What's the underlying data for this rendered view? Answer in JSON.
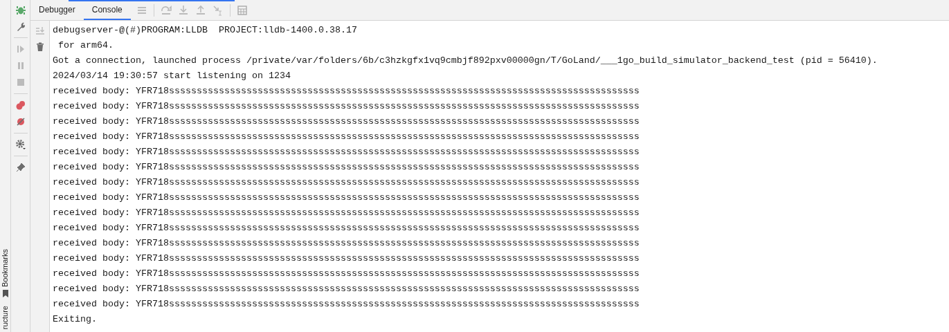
{
  "side_bar": {
    "items": [
      {
        "label": "Bookmarks"
      },
      {
        "label": "ructure"
      }
    ]
  },
  "tabs": [
    {
      "label": "Debugger",
      "selected": false
    },
    {
      "label": "Console",
      "selected": true
    }
  ],
  "console": {
    "lines": [
      "debugserver-@(#)PROGRAM:LLDB  PROJECT:lldb-1400.0.38.17",
      " for arm64.",
      "Got a connection, launched process /private/var/folders/6b/c3hzkgfx1vq9cmbjf892pxv00000gn/T/GoLand/___1go_build_simulator_backend_test (pid = 56410).",
      "2024/03/14 19:30:57 start listening on 1234",
      "received body: YFR718sssssssssssssssssssssssssssssssssssssssssssssssssssssssssssssssssssssssssssssssssssss",
      "received body: YFR718sssssssssssssssssssssssssssssssssssssssssssssssssssssssssssssssssssssssssssssssssssss",
      "received body: YFR718sssssssssssssssssssssssssssssssssssssssssssssssssssssssssssssssssssssssssssssssssssss",
      "received body: YFR718sssssssssssssssssssssssssssssssssssssssssssssssssssssssssssssssssssssssssssssssssssss",
      "received body: YFR718sssssssssssssssssssssssssssssssssssssssssssssssssssssssssssssssssssssssssssssssssssss",
      "received body: YFR718sssssssssssssssssssssssssssssssssssssssssssssssssssssssssssssssssssssssssssssssssssss",
      "received body: YFR718sssssssssssssssssssssssssssssssssssssssssssssssssssssssssssssssssssssssssssssssssssss",
      "received body: YFR718sssssssssssssssssssssssssssssssssssssssssssssssssssssssssssssssssssssssssssssssssssss",
      "received body: YFR718sssssssssssssssssssssssssssssssssssssssssssssssssssssssssssssssssssssssssssssssssssss",
      "received body: YFR718sssssssssssssssssssssssssssssssssssssssssssssssssssssssssssssssssssssssssssssssssssss",
      "received body: YFR718sssssssssssssssssssssssssssssssssssssssssssssssssssssssssssssssssssssssssssssssssssss",
      "received body: YFR718sssssssssssssssssssssssssssssssssssssssssssssssssssssssssssssssssssssssssssssssssssss",
      "received body: YFR718sssssssssssssssssssssssssssssssssssssssssssssssssssssssssssssssssssssssssssssssssssss",
      "received body: YFR718sssssssssssssssssssssssssssssssssssssssssssssssssssssssssssssssssssssssssssssssssssss",
      "received body: YFR718sssssssssssssssssssssssssssssssssssssssssssssssssssssssssssssssssssssssssssssssssssss",
      "Exiting."
    ]
  }
}
